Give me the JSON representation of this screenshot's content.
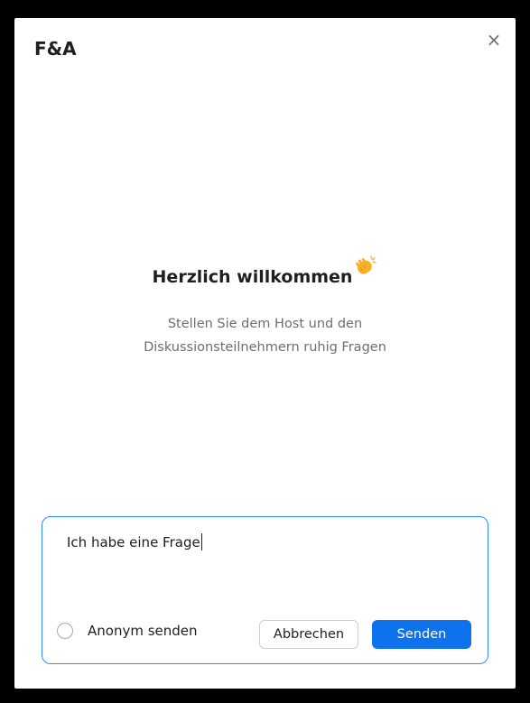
{
  "panel": {
    "title": "F&A",
    "close_icon": "close-icon",
    "close_glyph": "×"
  },
  "welcome": {
    "heading": "Herzlich willkommen",
    "heading_icon": "clapping-hands-icon",
    "subtitle": "Stellen Sie dem Host und den Diskussionsteilnehmern ruhig Fragen"
  },
  "composer": {
    "input_value": "Ich habe eine Frage",
    "anonymous_label": "Anonym senden",
    "anonymous_checked": false,
    "cancel_label": "Abbrechen",
    "send_label": "Senden"
  },
  "colors": {
    "accent": "#0e72ed",
    "focus_border": "#2d8cff",
    "muted_text": "#6e6e6e",
    "background": "#000000"
  }
}
